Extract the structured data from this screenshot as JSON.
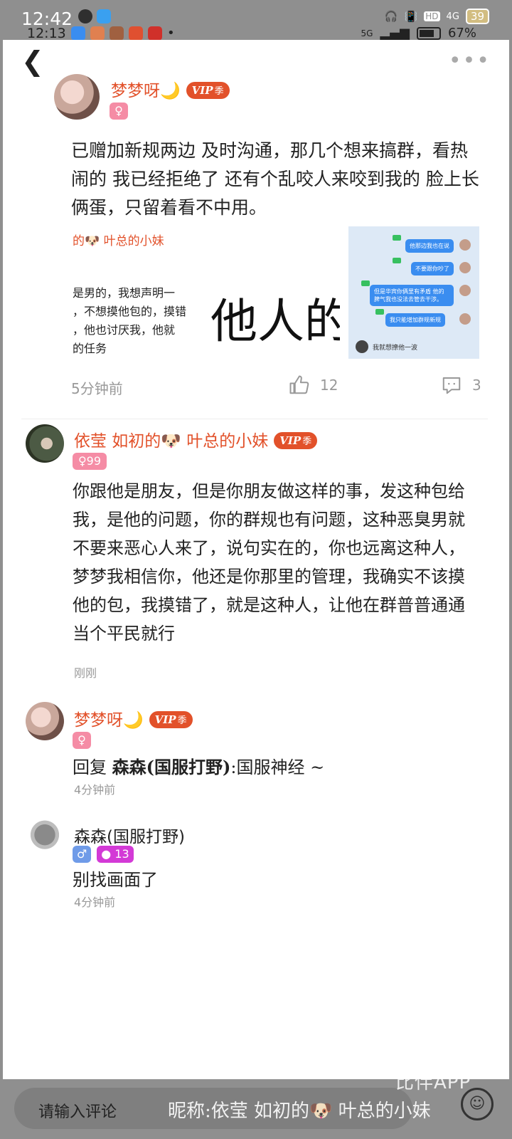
{
  "status_bar": {
    "time_top": "12:42",
    "time_bottom": "12:13",
    "battery_top": "39",
    "battery_bottom": "67%",
    "net_4g": "4G",
    "net_5g": "5G",
    "hd": "HD"
  },
  "post": {
    "author": "梦梦呀🌙",
    "vip_label": "VIP",
    "vip_season": "季",
    "gender": "♀",
    "text": "已赠加新规两边 及时沟通，那几个想来搞群，看热闹的 我已经拒绝了 还有个乱咬人来咬到我的 脸上长俩蛋，只留着看不中用。",
    "image1": {
      "title": "的🐶 叶总的小妹",
      "lines": [
        "是男的，我想声明一",
        "，不想摸他包的，摸错",
        "，他也讨厌我，他就",
        "的任务"
      ]
    },
    "image2": {
      "text": "他人的"
    },
    "image3": {
      "bubbles": [
        "他那边我也在说",
        "不要跟你吵了",
        "但是华宾你俩里有矛盾 他的脾气我也没法去管去干涉。",
        "我只能增加群规新规"
      ],
      "footer": "我就想撩他一波"
    },
    "time": "5分钟前",
    "likes": "12",
    "comments": "3"
  },
  "comments": [
    {
      "author": "依莹 如初的🐶 叶总的小妹",
      "vip_label": "VIP",
      "vip_season": "季",
      "gender_badge": "♀99",
      "text": "你跟他是朋友，但是你朋友做这样的事，发这种包给我，是他的问题，你的群规也有问题，这种恶臭男就不要来恶心人来了，说句实在的，你也远离这种人，梦梦我相信你，他还是你那里的管理，我确实不该摸他的包，我摸错了，就是这种人，让他在群普普通通当个平民就行",
      "time": "刚刚"
    },
    {
      "author": "梦梦呀🌙",
      "vip_label": "VIP",
      "vip_season": "季",
      "gender_badge": "♀",
      "reply_prefix": "回复 ",
      "reply_to": "森森(国服打野)",
      "reply_text": ":国服神经 ~",
      "time": "4分钟前"
    },
    {
      "author": "森森(国服打野)",
      "gender_badge": "♂",
      "level_badge": "13",
      "text": "别找画面了",
      "time": "4分钟前"
    }
  ],
  "input": {
    "placeholder": "请输入评论"
  },
  "watermark": {
    "app": "比伴APP",
    "nickname": "昵称:依莹 如初的🐶 叶总的小妹"
  }
}
